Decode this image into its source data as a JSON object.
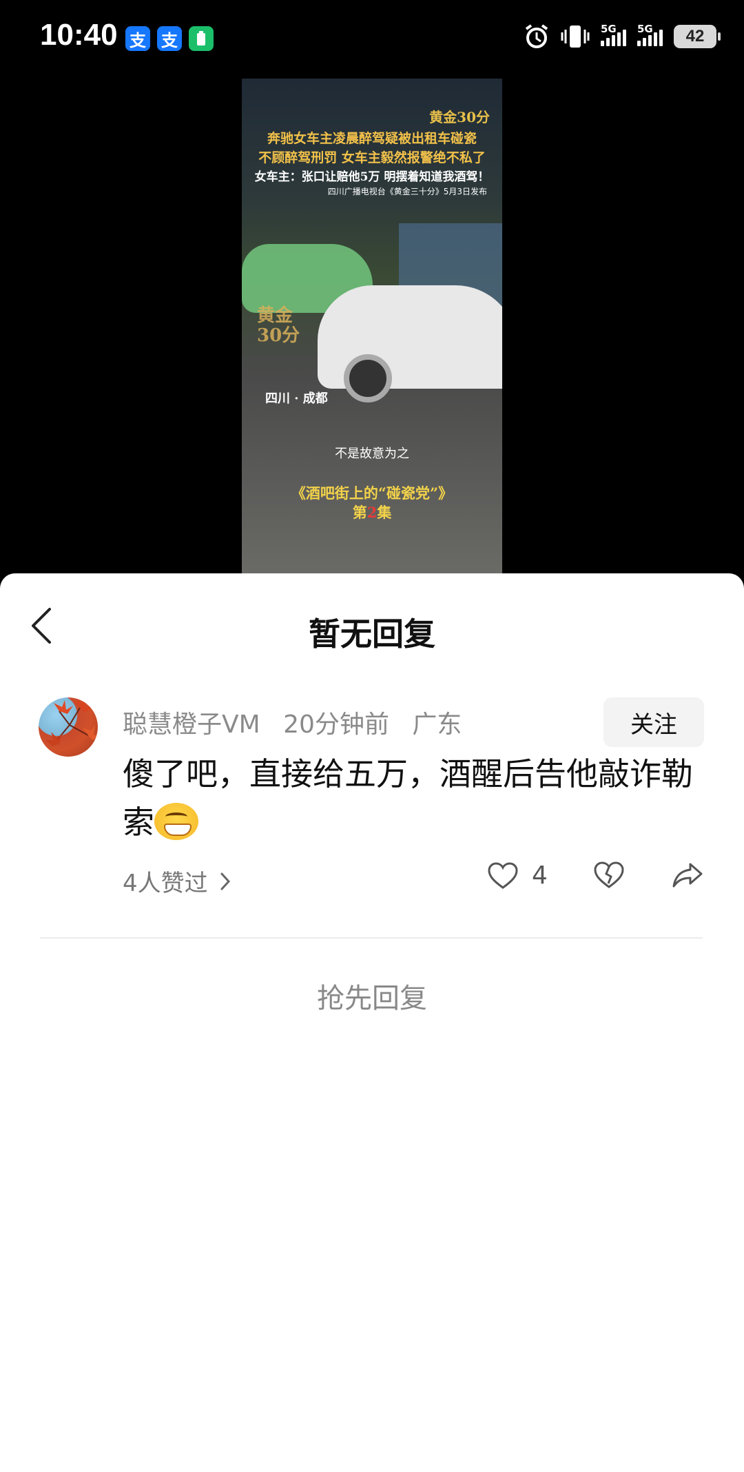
{
  "status_bar": {
    "time": "10:40",
    "apps": [
      {
        "icon": "alipay-icon",
        "glyph": "支"
      },
      {
        "icon": "alipay-icon",
        "glyph": "支"
      },
      {
        "icon": "battery-app-icon",
        "glyph": "▮"
      }
    ],
    "network1": "5G",
    "network2": "5G",
    "battery": "42",
    "icons": [
      "alarm-icon",
      "vibrate-icon",
      "signal-icon",
      "battery-icon"
    ]
  },
  "video": {
    "brand": "黄金30分",
    "headline_1": "奔驰女车主凌晨醉驾疑被出租车碰瓷",
    "headline_2": "不顾醉驾刑罚 女车主毅然报警绝不私了",
    "headline_3": "女车主：张口让赔他5万 明摆着知道我酒驾！",
    "source": "四川广播电视台《黄金三十分》5月3日发布",
    "watermark_1": "黄金",
    "watermark_2": "30分",
    "location": "四川 · 成都",
    "subtitle": "不是故意为之",
    "episode_title": "《酒吧街上的“碰瓷党”》",
    "episode_pre": "第",
    "episode_num": "2",
    "episode_post": "集"
  },
  "sheet": {
    "title": "暂无回复",
    "comment": {
      "username": "聪慧橙子VM",
      "time": "20分钟前",
      "region": "广东",
      "follow_label": "关注",
      "text": "傻了吧，直接给五万，酒醒后告他敲诈勒索",
      "emoji": "grin-emoji",
      "likers": "4人赞过",
      "like_count": "4"
    },
    "reply_first_label": "抢先回复"
  },
  "colors": {
    "sheet_bg": "#ffffff",
    "page_bg": "#000000",
    "meta_text": "#8a8a8a",
    "follow_bg": "#f3f3f3"
  }
}
